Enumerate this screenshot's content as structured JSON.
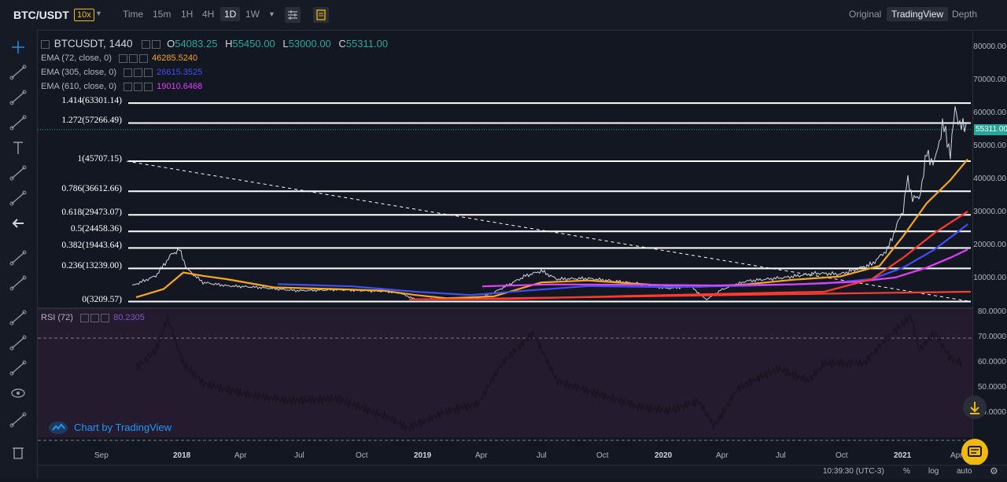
{
  "header": {
    "symbol": "BTC/USDT",
    "leverage": "10x",
    "timeframes": [
      "Time",
      "15m",
      "1H",
      "4H",
      "1D",
      "1W"
    ],
    "active_timeframe": "1D",
    "views": [
      "Original",
      "TradingView",
      "Depth"
    ],
    "active_view": "TradingView"
  },
  "legend": {
    "title": "BTCUSDT, 1440",
    "ohlc": {
      "o_label": "O",
      "o": "54083.25",
      "h_label": "H",
      "h": "55450.00",
      "l_label": "L",
      "l": "53000.00",
      "c_label": "C",
      "c": "55311.00"
    },
    "indicators": [
      {
        "name": "EMA (72, close, 0)",
        "value": "46285.5240",
        "color": "#f5a623"
      },
      {
        "name": "EMA (305, close, 0)",
        "value": "26615.3525",
        "color": "#3f51f5"
      },
      {
        "name": "EMA (610, close, 0)",
        "value": "19010.6468",
        "color": "#e040fb"
      }
    ],
    "rsi_name": "RSI (72)",
    "rsi_value": "80.2305"
  },
  "fib_levels": [
    {
      "label": "1.414(63301.14)",
      "price": 63301.14
    },
    {
      "label": "1.272(57266.49)",
      "price": 57266.49
    },
    {
      "label": "1(45707.15)",
      "price": 45707.15
    },
    {
      "label": "0.786(36612.66)",
      "price": 36612.66
    },
    {
      "label": "0.618(29473.07)",
      "price": 29473.07
    },
    {
      "label": "0.5(24458.36)",
      "price": 24458.36
    },
    {
      "label": "0.382(19443.64)",
      "price": 19443.64
    },
    {
      "label": "0.236(13239.00)",
      "price": 13239.0
    },
    {
      "label": "0(3209.57)",
      "price": 3209.57
    }
  ],
  "price_axis": [
    "80000.00",
    "70000.00",
    "60000.00",
    "50000.00",
    "40000.00",
    "30000.00",
    "20000.00",
    "10000.00"
  ],
  "last_price": "55311.00",
  "rsi_axis": [
    "80.0000",
    "70.0000",
    "60.0000",
    "50.0000",
    "40.0000"
  ],
  "time_axis": [
    "Sep",
    "2018",
    "Apr",
    "Jul",
    "Oct",
    "2019",
    "Apr",
    "Jul",
    "Oct",
    "2020",
    "Apr",
    "Jul",
    "Oct",
    "2021",
    "Apr"
  ],
  "watermark": "Chart by TradingView",
  "bottom_bar": {
    "time": "10:39:30 (UTC-3)",
    "percent": "%",
    "log": "log",
    "auto": "auto"
  },
  "colors": {
    "up": "#26a69a",
    "ema72": "#f5a623",
    "ema305": "#3f51f5",
    "ema610": "#e040fb",
    "ema_long": "#ff3b30",
    "fib_line": "#ffffff"
  },
  "icons": [
    "crosshair-icon",
    "trend-line-icon",
    "fib-tool-icon",
    "brush-icon",
    "text-icon",
    "pattern-icon",
    "prediction-icon",
    "back-arrow-icon",
    "ruler-icon",
    "zoom-icon",
    "magnet-icon",
    "lock-drawing-icon",
    "lock-icon",
    "eye-icon",
    "layers-icon",
    "trash-icon"
  ]
}
